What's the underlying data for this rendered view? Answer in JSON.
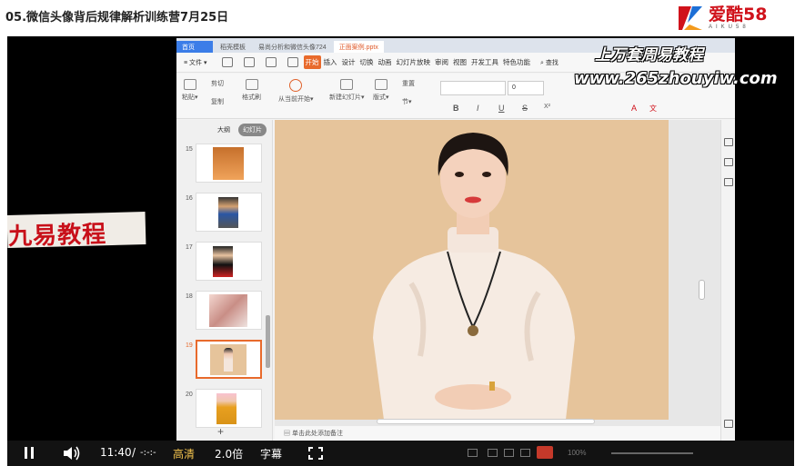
{
  "page": {
    "title": "05.微信头像背后规律解析训练营7月25日"
  },
  "logo": {
    "main": "爱酷58",
    "sub": "AIKU58",
    "colors": {
      "red": "#d0121b",
      "blue": "#1d6fd6",
      "orange": "#f39a1c"
    }
  },
  "watermarks": {
    "top": "上万套周易教程",
    "url": "www.265zhouyiw.com",
    "left": "九易教程"
  },
  "app": {
    "tabs": [
      {
        "label": "首页",
        "state": "home"
      },
      {
        "label": "稻壳模板",
        "state": "normal"
      },
      {
        "label": "易尚分析和微信头像724",
        "state": "normal"
      },
      {
        "label": "正面案例.pptx",
        "state": "active"
      }
    ],
    "menu": {
      "file": "≡ 文件 ▾",
      "items": [
        "开始",
        "插入",
        "设计",
        "切换",
        "动画",
        "幻灯片放映",
        "审阅",
        "视图",
        "开发工具",
        "特色功能"
      ],
      "active_index": 0,
      "search": "查找"
    },
    "ribbon": {
      "paste": "粘贴▾",
      "cut": "剪切",
      "copy": "复制",
      "format_painter": "格式刷",
      "play_from_current": "从当前开始▾",
      "new_slide": "新建幻灯片▾",
      "layout": "版式▾",
      "reset": "重置",
      "section": "节▾",
      "font_size": "0",
      "format_buttons": [
        "B",
        "I",
        "U",
        "S",
        "X²",
        "A",
        "文"
      ]
    },
    "sidepane": {
      "tabs": [
        "大纲",
        "幻灯片"
      ],
      "active_tab": 1,
      "slides": [
        {
          "num": "15",
          "selected": false
        },
        {
          "num": "16",
          "selected": false
        },
        {
          "num": "17",
          "selected": false
        },
        {
          "num": "18",
          "selected": false
        },
        {
          "num": "19",
          "selected": true
        },
        {
          "num": "20",
          "selected": false
        }
      ],
      "add": "+"
    },
    "notes_placeholder": "单击此处添加备注",
    "slide_background": "#e6c49b"
  },
  "player": {
    "time_current": "11:40",
    "time_sep": "/",
    "time_total": "-:-:-",
    "quality": "高清",
    "speed": "2.0倍",
    "subtitle": "字幕",
    "status_zoom": "100%",
    "accent": "#f5c54e"
  }
}
